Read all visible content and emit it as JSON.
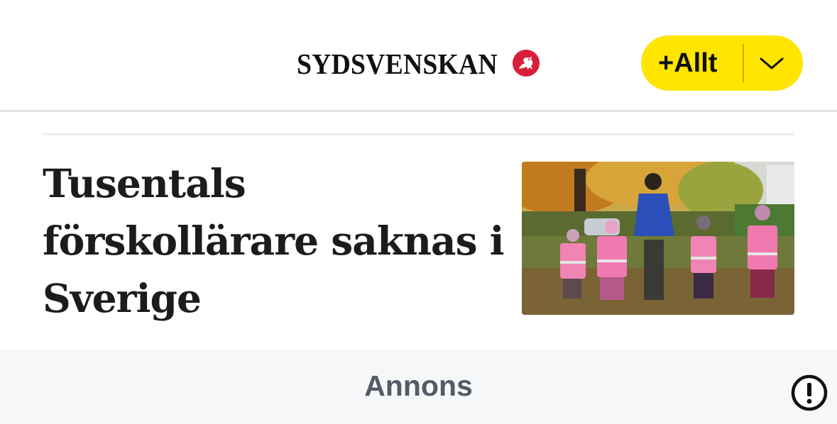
{
  "header": {
    "logo_text": "SYDSVENSKAN",
    "plus_button_label": "+Allt",
    "brand_color": "#ffe500",
    "emblem_color": "#d81f3a"
  },
  "article": {
    "headline": "Tusentals förskollärare saknas i Sverige",
    "image": "preschool-teacher-with-children-in-reflective-vests-photo"
  },
  "ad": {
    "label": "Annons"
  },
  "icons": {
    "dropdown": "chevron-down-icon",
    "ad_info": "exclamation-circle-icon"
  }
}
